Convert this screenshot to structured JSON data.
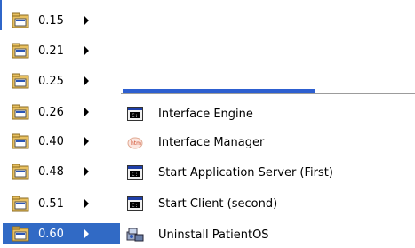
{
  "version_menu": {
    "items": [
      {
        "label": "0.15",
        "icon": "program-group-icon",
        "has_submenu": true,
        "selected": false
      },
      {
        "label": "0.21",
        "icon": "program-group-icon",
        "has_submenu": true,
        "selected": false
      },
      {
        "label": "0.25",
        "icon": "program-group-icon",
        "has_submenu": true,
        "selected": false
      },
      {
        "label": "0.26",
        "icon": "program-group-icon",
        "has_submenu": true,
        "selected": false
      },
      {
        "label": "0.40",
        "icon": "program-group-icon",
        "has_submenu": true,
        "selected": false
      },
      {
        "label": "0.48",
        "icon": "program-group-icon",
        "has_submenu": true,
        "selected": false
      },
      {
        "label": "0.51",
        "icon": "program-group-icon",
        "has_submenu": true,
        "selected": false
      },
      {
        "label": "0.60",
        "icon": "program-group-icon",
        "has_submenu": true,
        "selected": true
      }
    ]
  },
  "submenu": {
    "items": [
      {
        "label": "Interface Engine",
        "icon": "console-app-icon"
      },
      {
        "label": "Interface Manager",
        "icon": "web-page-icon"
      },
      {
        "label": "Start Application Server (First)",
        "icon": "console-app-icon"
      },
      {
        "label": "Start Client (second)",
        "icon": "console-app-icon"
      },
      {
        "label": "Uninstall PatientOS",
        "icon": "uninstall-icon"
      }
    ]
  },
  "colors": {
    "selection": "#316ac5",
    "folder": "#e8c060"
  }
}
